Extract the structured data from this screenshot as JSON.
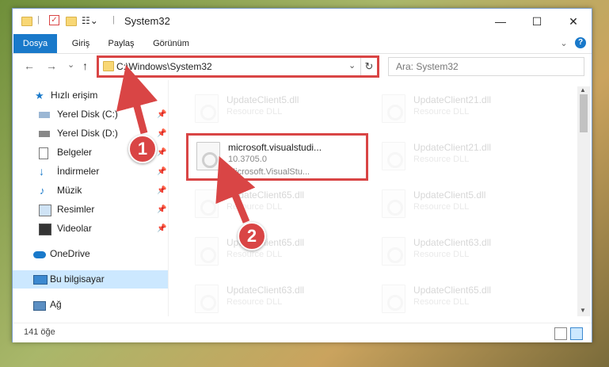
{
  "titlebar": {
    "title": "System32",
    "minimize": "—",
    "maximize": "☐",
    "close": "✕"
  },
  "ribbon": {
    "tabs": [
      "Dosya",
      "Giriş",
      "Paylaş",
      "Görünüm"
    ],
    "help": "?",
    "expand": "⌄"
  },
  "address": {
    "path": "C:\\Windows\\System32",
    "refresh": "↻",
    "dropdown": "⌄"
  },
  "nav": {
    "back": "←",
    "forward": "→",
    "recent": "⌄",
    "up": "↑"
  },
  "search": {
    "placeholder": "Ara: System32"
  },
  "sidebar": {
    "items": [
      {
        "label": "Hızlı erişim",
        "pinned": false
      },
      {
        "label": "Yerel Disk (C:)",
        "pinned": true
      },
      {
        "label": "Yerel Disk (D:)",
        "pinned": true
      },
      {
        "label": "Belgeler",
        "pinned": true
      },
      {
        "label": "İndirmeler",
        "pinned": true
      },
      {
        "label": "Müzik",
        "pinned": true
      },
      {
        "label": "Resimler",
        "pinned": true
      },
      {
        "label": "Videolar",
        "pinned": true
      },
      {
        "label": "OneDrive",
        "pinned": false
      },
      {
        "label": "Bu bilgisayar",
        "pinned": false
      },
      {
        "label": "Ağ",
        "pinned": false
      }
    ]
  },
  "files": {
    "selected": {
      "name": "microsoft.visualstudi...",
      "version": "10.3705.0",
      "company": "Microsoft.VisualStu..."
    },
    "left_col": [
      {
        "name": "UpdateClient5.dll",
        "desc": "Resource DLL"
      },
      {
        "name": "UpdateClient65.dll",
        "desc": "Resource DLL"
      },
      {
        "name": "UpdateClient65.dll",
        "desc": "Resource DLL"
      },
      {
        "name": "UpdateClient63.dll",
        "desc": "Resource DLL"
      }
    ],
    "right_col": [
      {
        "name": "UpdateClient21.dll",
        "desc": "Resource DLL"
      },
      {
        "name": "UpdateClient21.dll",
        "desc": "Resource DLL"
      },
      {
        "name": "UpdateClient5.dll",
        "desc": "Resource DLL"
      },
      {
        "name": "UpdateClient63.dll",
        "desc": "Resource DLL"
      },
      {
        "name": "UpdateClient65.dll",
        "desc": "Resource DLL"
      }
    ]
  },
  "status": {
    "count": "141 öğe"
  },
  "callouts": [
    "1",
    "2"
  ],
  "colors": {
    "accent": "#1979ca",
    "highlight": "#d94545",
    "selected": "#cce8ff"
  }
}
